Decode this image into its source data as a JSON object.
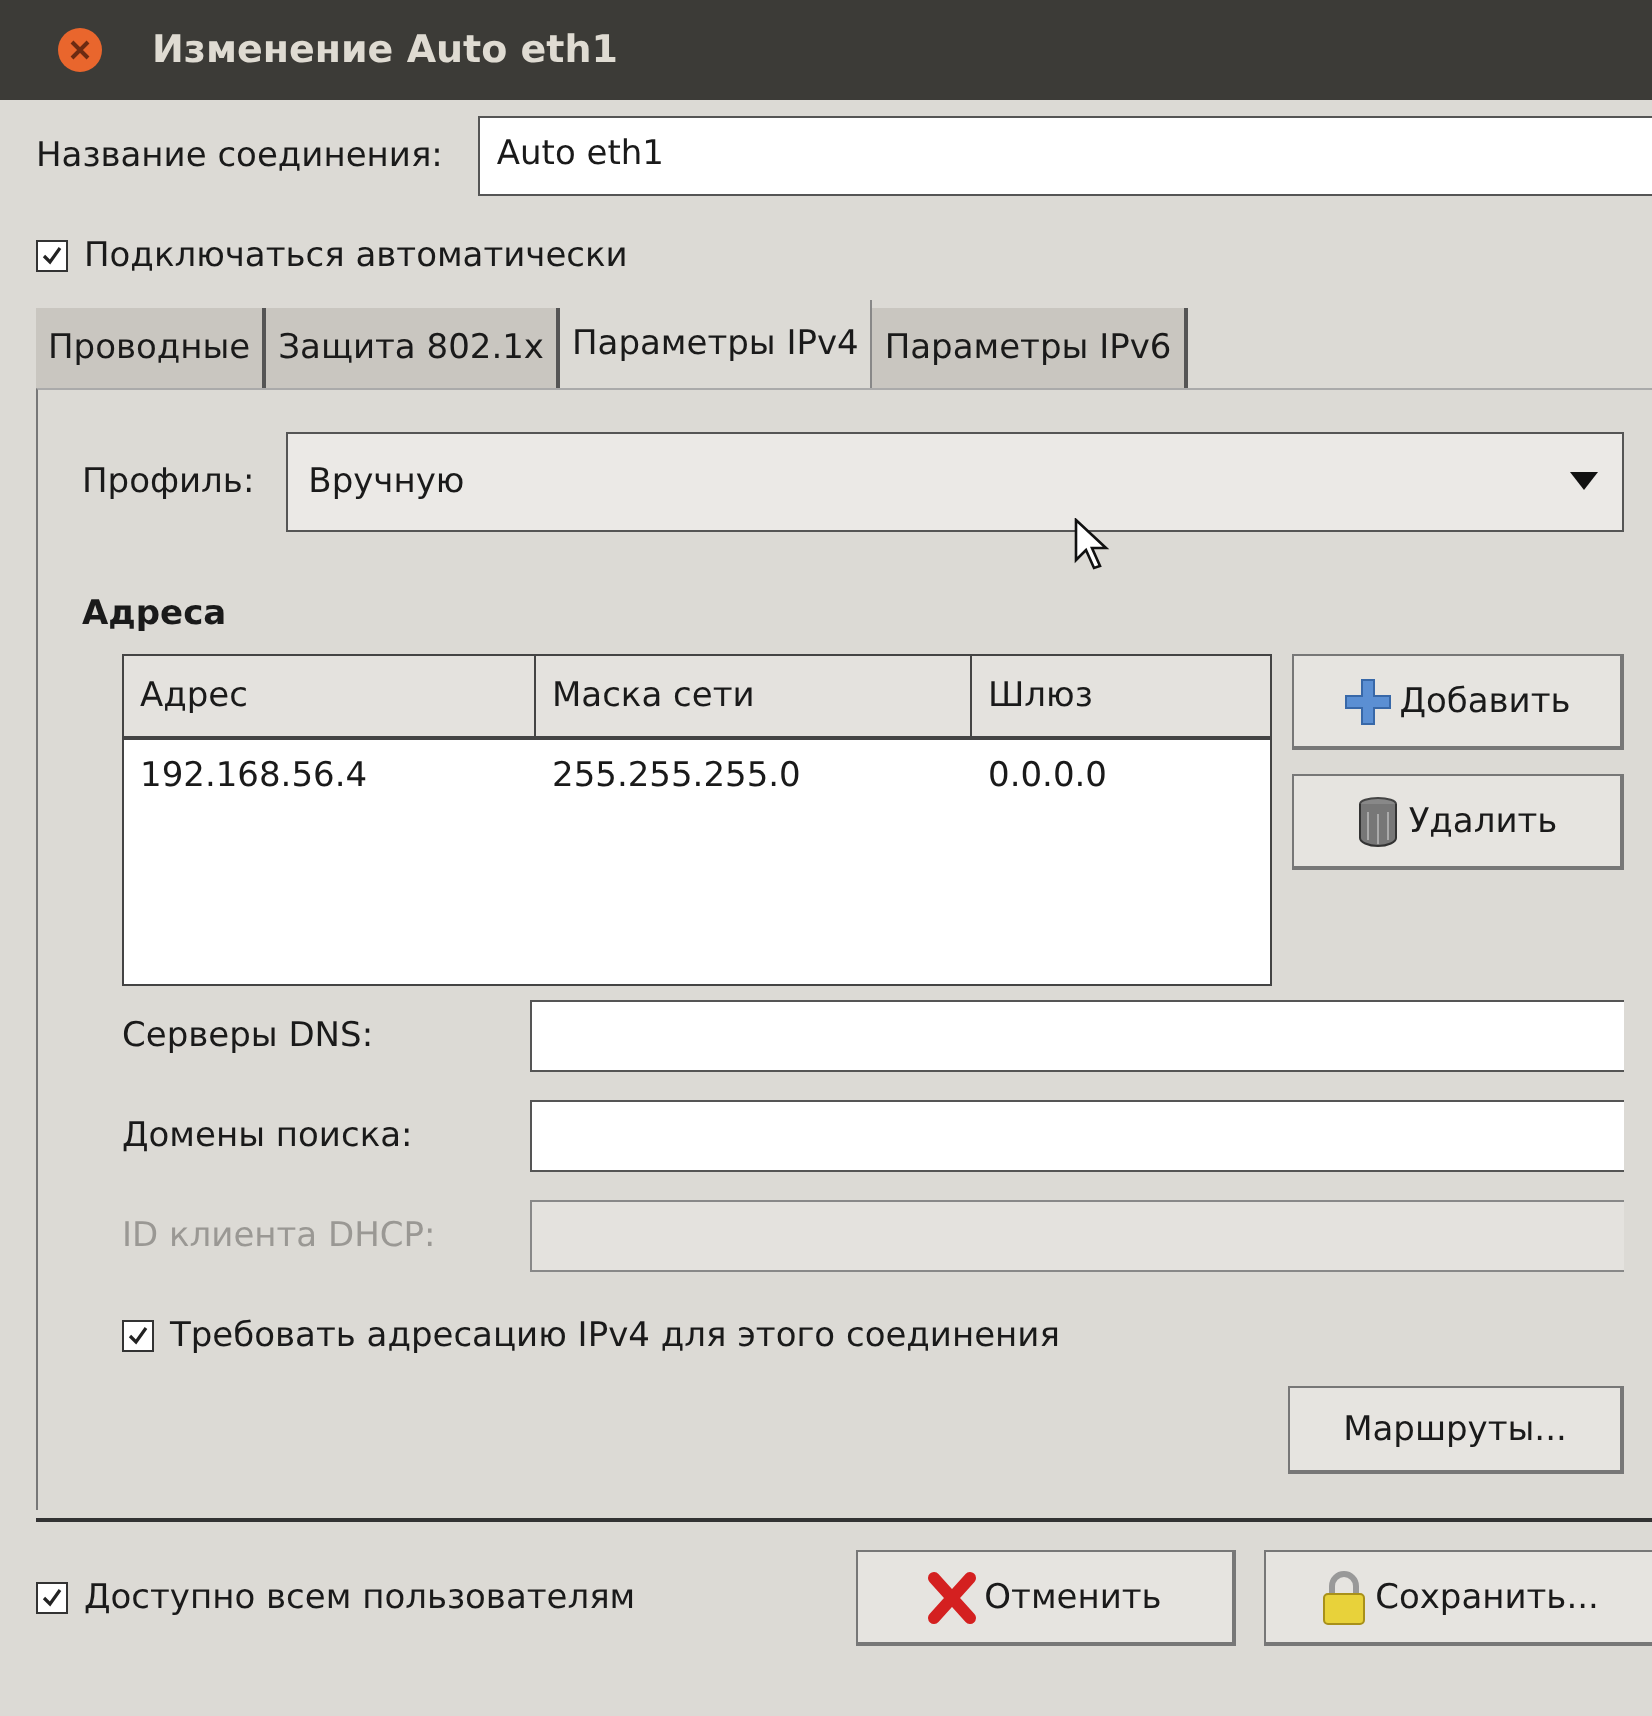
{
  "window": {
    "title": "Изменение Auto eth1"
  },
  "connection_name": {
    "label": "Название соединения:",
    "value": "Auto eth1"
  },
  "auto_connect": {
    "label": "Подключаться автоматически",
    "checked": true
  },
  "tabs": [
    {
      "label": "Проводные",
      "selected": false
    },
    {
      "label": "Защита 802.1x",
      "selected": false
    },
    {
      "label": "Параметры IPv4",
      "selected": true
    },
    {
      "label": "Параметры IPv6",
      "selected": false
    }
  ],
  "profile": {
    "label": "Профиль:",
    "value": "Вручную"
  },
  "addresses": {
    "title": "Адреса",
    "columns": [
      "Адрес",
      "Маска сети",
      "Шлюз"
    ],
    "rows": [
      [
        "192.168.56.4",
        "255.255.255.0",
        "0.0.0.0"
      ]
    ],
    "buttons": [
      {
        "label": "Добавить",
        "kind": "add"
      },
      {
        "label": "Удалить",
        "kind": "delete"
      }
    ]
  },
  "fields": [
    {
      "label": "Серверы DNS:",
      "disabled": false
    },
    {
      "label": "Домены поиска:",
      "disabled": false
    },
    {
      "label": "ID клиента DHCP:",
      "disabled": true
    }
  ],
  "require_ipv4": {
    "label": "Требовать адресацию IPv4 для этого соединения",
    "checked": true
  },
  "routes_button": "Маршруты...",
  "all_users": {
    "label": "Доступно всем пользователям",
    "checked": true
  },
  "buttons": [
    {
      "label": "Отменить",
      "kind": "cancel"
    },
    {
      "label": "Сохранить...",
      "kind": "save"
    }
  ]
}
